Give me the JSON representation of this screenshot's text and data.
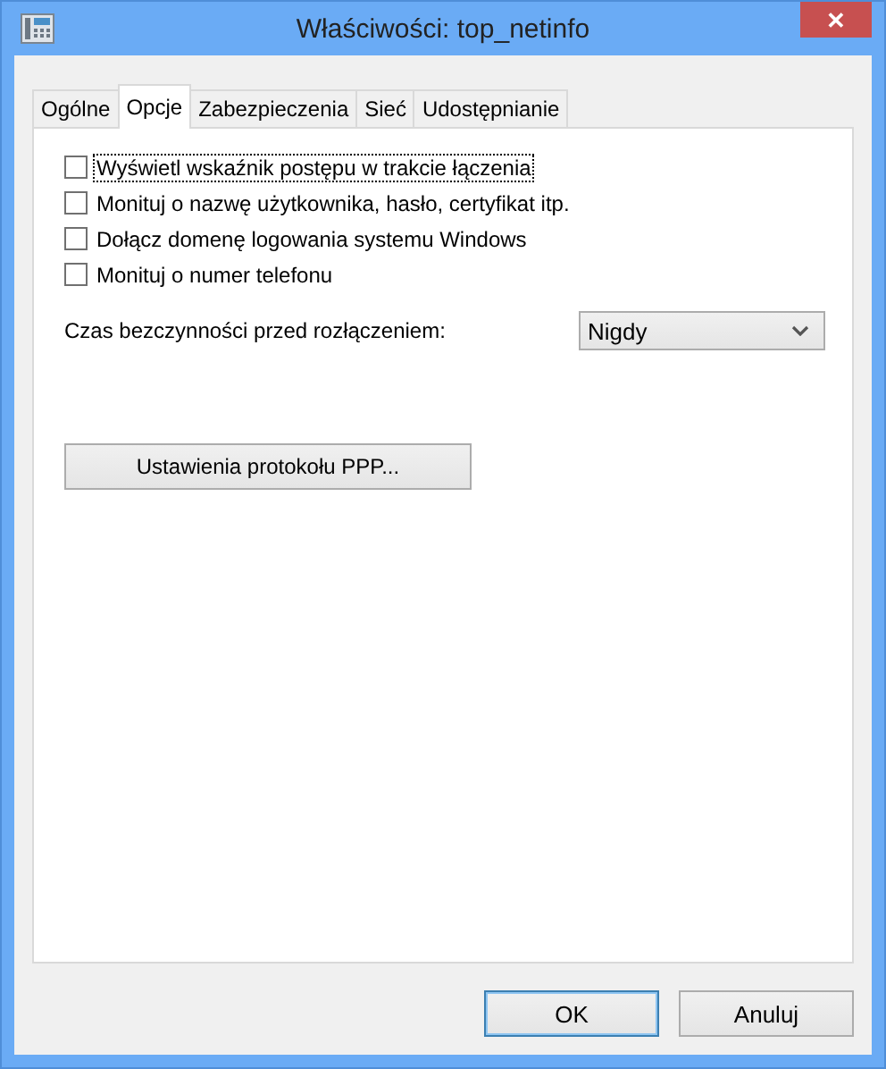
{
  "window": {
    "title": "Właściwości: top_netinfo",
    "close_label": "✕"
  },
  "tabs": [
    {
      "label": "Ogólne",
      "selected": false
    },
    {
      "label": "Opcje",
      "selected": true
    },
    {
      "label": "Zabezpieczenia",
      "selected": false
    },
    {
      "label": "Sieć",
      "selected": false
    },
    {
      "label": "Udostępnianie",
      "selected": false
    }
  ],
  "options": [
    {
      "label": "Wyświetl wskaźnik postępu w trakcie łączenia",
      "checked": false,
      "focused": true
    },
    {
      "label": "Monituj o nazwę użytkownika, hasło, certyfikat itp.",
      "checked": false,
      "focused": false
    },
    {
      "label": "Dołącz domenę logowania systemu Windows",
      "checked": false,
      "focused": false
    },
    {
      "label": "Monituj o numer telefonu",
      "checked": false,
      "focused": false
    }
  ],
  "idle": {
    "label": "Czas bezczynności przed rozłączeniem:",
    "value": "Nigdy"
  },
  "ppp_button": "Ustawienia protokołu PPP...",
  "buttons": [
    {
      "label": "OK",
      "default": true
    },
    {
      "label": "Anuluj",
      "default": false
    }
  ]
}
